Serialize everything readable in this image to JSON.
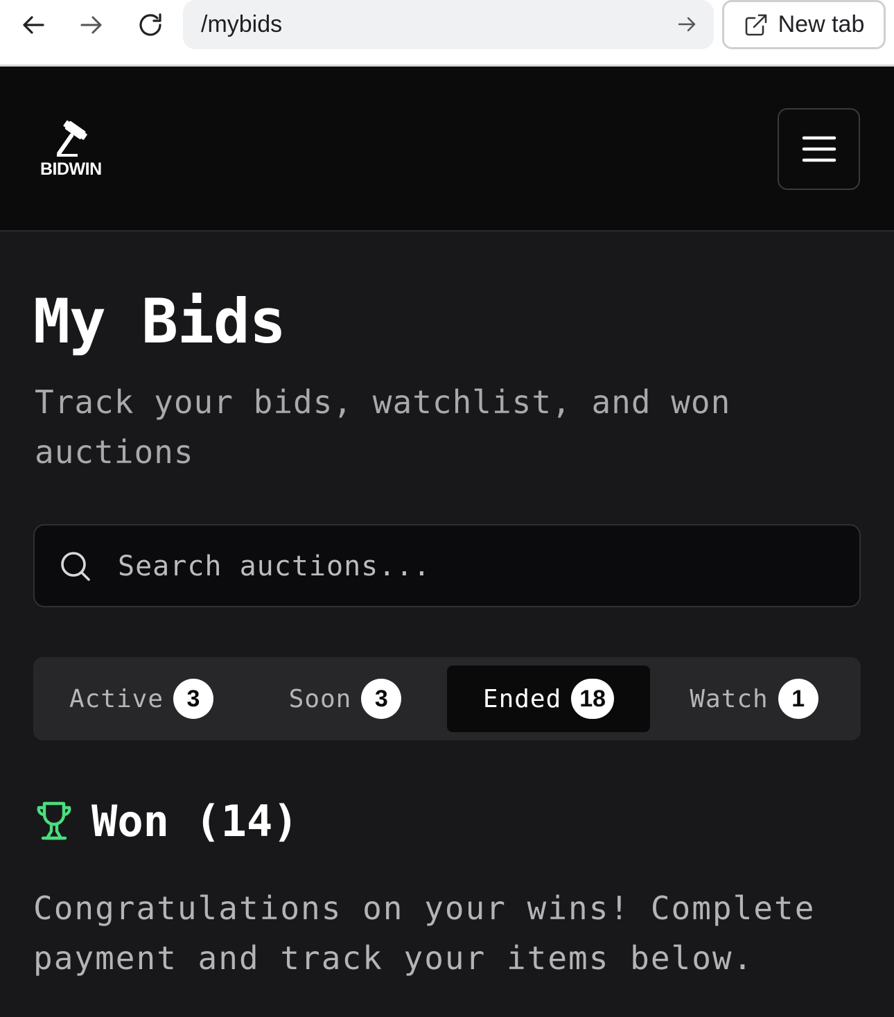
{
  "browser": {
    "url": "/mybids",
    "new_tab_label": "New tab"
  },
  "app": {
    "logo_text": "BIDWIN"
  },
  "page": {
    "title": "My Bids",
    "subtitle": "Track your bids, watchlist, and won auctions"
  },
  "search": {
    "placeholder": "Search auctions..."
  },
  "tabs": [
    {
      "label": "Active",
      "count": "3"
    },
    {
      "label": "Soon",
      "count": "3"
    },
    {
      "label": "Ended",
      "count": "18"
    },
    {
      "label": "Watch",
      "count": "1"
    }
  ],
  "active_tab": "Ended",
  "won": {
    "heading": "Won (14)",
    "message": "Congratulations on your wins! Complete payment and track your items below."
  },
  "colors": {
    "accent_green": "#4ade80",
    "background": "#18181a",
    "header": "#0b0b0c"
  }
}
